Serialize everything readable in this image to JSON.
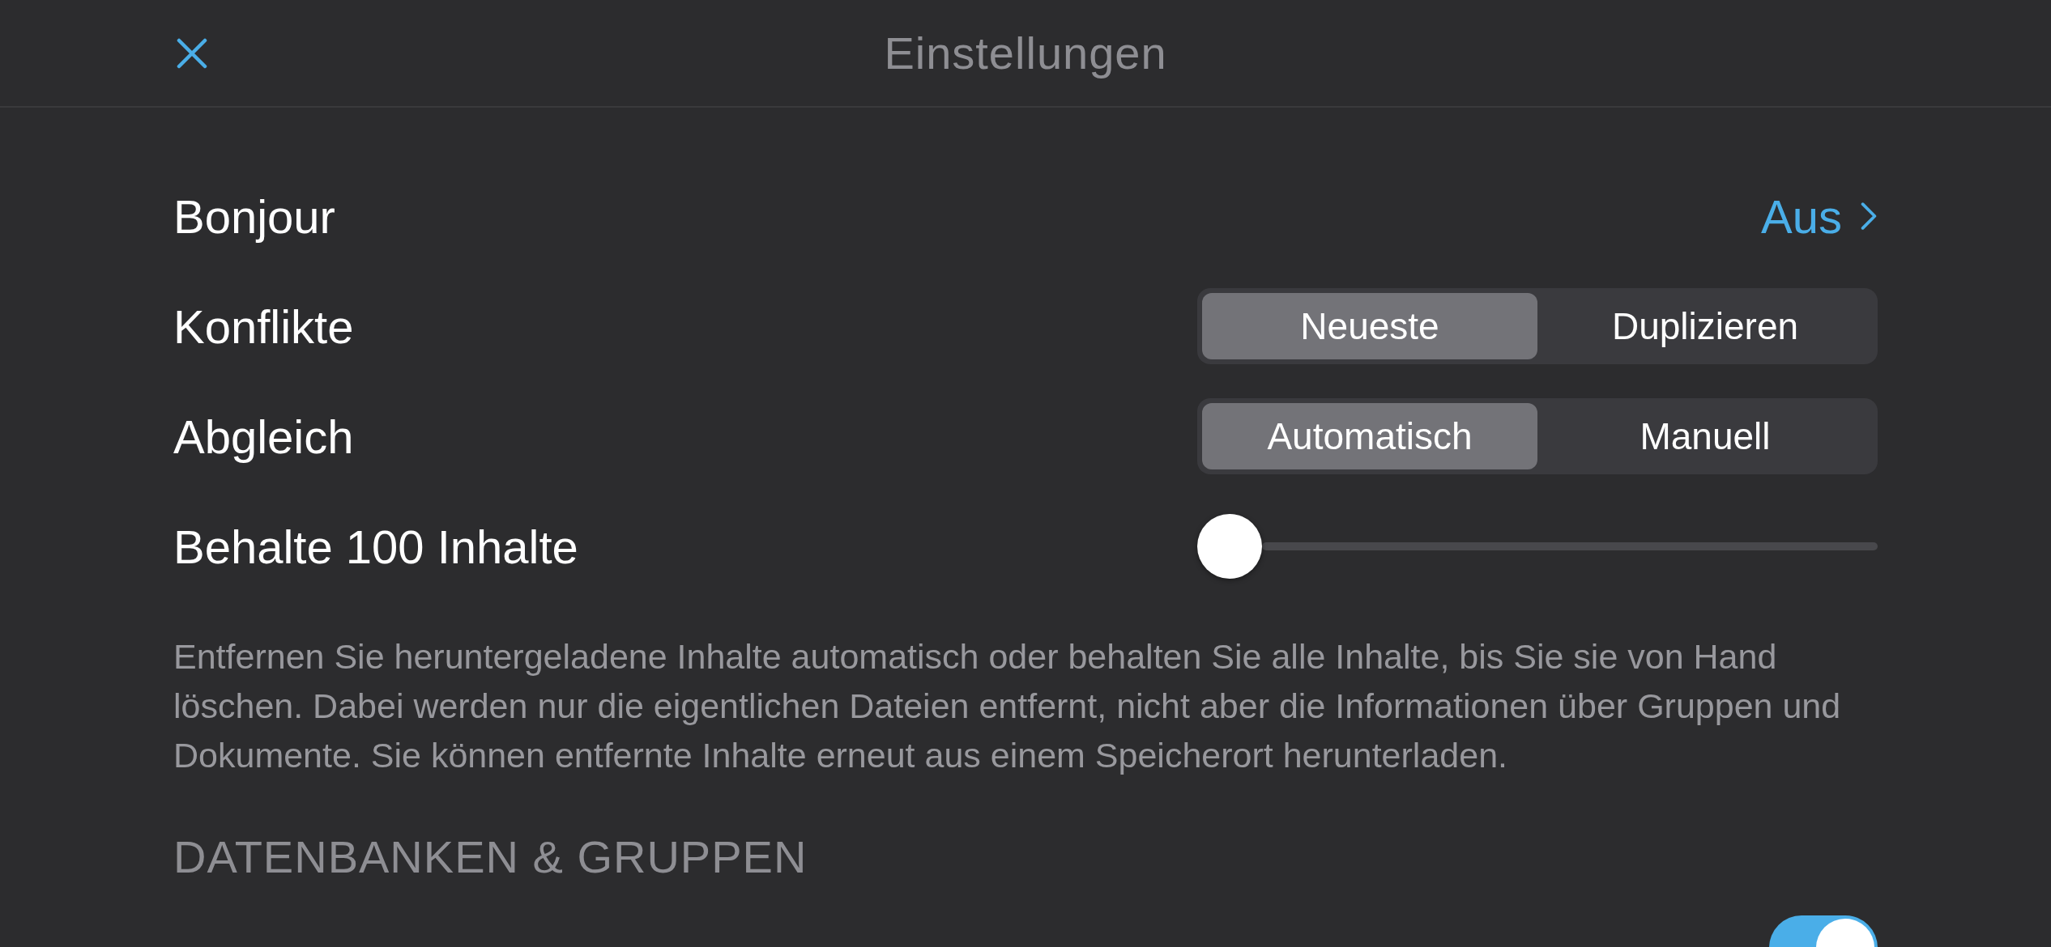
{
  "header": {
    "title": "Einstellungen"
  },
  "rows": [
    {
      "kind": "link",
      "label": "Bonjour",
      "value": "Aus"
    },
    {
      "kind": "segmented",
      "label": "Konflikte",
      "options": [
        {
          "label": "Neueste",
          "selected": true
        },
        {
          "label": "Duplizieren",
          "selected": false
        }
      ]
    },
    {
      "kind": "segmented",
      "label": "Abgleich",
      "options": [
        {
          "label": "Automatisch",
          "selected": true
        },
        {
          "label": "Manuell",
          "selected": false
        }
      ]
    },
    {
      "kind": "slider",
      "label": "Behalte 100 Inhalte",
      "level": 0
    }
  ],
  "description": "Entfernen Sie heruntergeladene Inhalte automatisch oder behalten Sie alle Inhalte, bis Sie sie von Hand löschen. Dabei werden nur die eigentlichen Dateien entfernt, nicht aber die Informationen über Gruppen und Dokumente. Sie können entfernte Inhalte erneut aus einem Speicherort herunterladen.",
  "section": {
    "title": "DATENBANKEN & GRUPPEN",
    "rows": [
      {
        "kind": "toggle",
        "on": true
      }
    ]
  }
}
